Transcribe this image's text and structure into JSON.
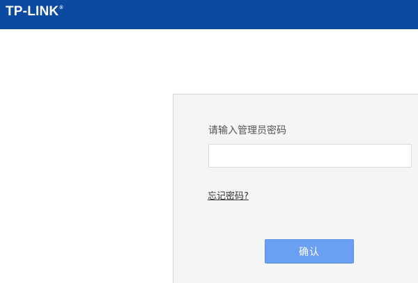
{
  "header": {
    "brand": "TP-LINK",
    "brand_mark": "®",
    "background_color": "#0b4aa0"
  },
  "login": {
    "prompt": "请输入管理员密码",
    "password_value": "",
    "password_placeholder": "",
    "forgot_link": "忘记密码?",
    "confirm_label": "确认",
    "button_color": "#6a9ff2"
  }
}
